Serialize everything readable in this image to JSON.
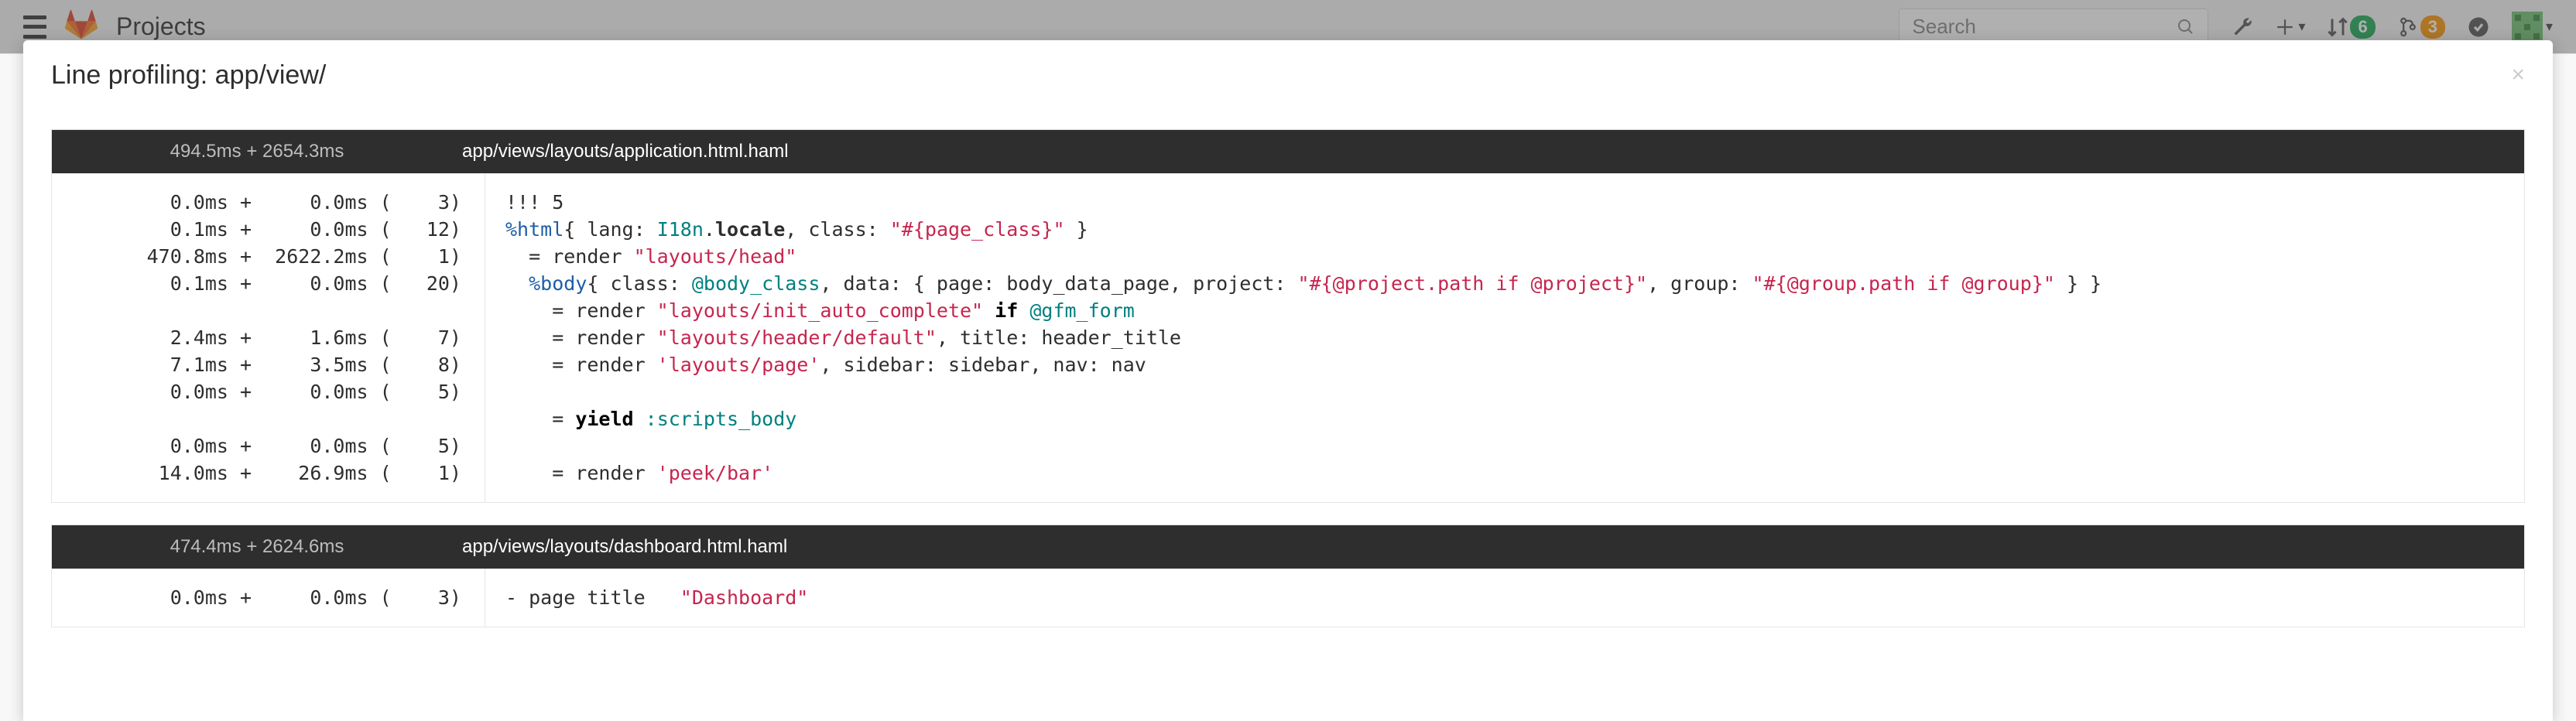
{
  "header": {
    "page_title": "Projects",
    "search_placeholder": "Search",
    "badge_mr": "6",
    "badge_issues": "3"
  },
  "modal": {
    "title": "Line profiling: app/view/",
    "close": "×"
  },
  "files": [
    {
      "timing_summary": "494.5ms + 2654.3ms",
      "path": "app/views/layouts/application.html.haml",
      "lines": [
        {
          "t": "0.0ms +     0.0ms (    3)",
          "code": [
            {
              "t": "!!! 5",
              "c": ""
            }
          ]
        },
        {
          "t": "0.1ms +     0.0ms (   12)",
          "code": [
            {
              "t": "%html",
              "c": "tok-tag"
            },
            {
              "t": "{ lang: ",
              "c": ""
            },
            {
              "t": "I18n",
              "c": "tok-key"
            },
            {
              "t": ".",
              "c": ""
            },
            {
              "t": "locale",
              "c": "tok-bold"
            },
            {
              "t": ", class: ",
              "c": ""
            },
            {
              "t": "\"#{page_class}\"",
              "c": "tok-str"
            },
            {
              "t": " }",
              "c": ""
            }
          ]
        },
        {
          "t": "470.8ms +  2622.2ms (    1)",
          "code": [
            {
              "t": "  = render ",
              "c": ""
            },
            {
              "t": "\"layouts/head\"",
              "c": "tok-str"
            }
          ]
        },
        {
          "t": "0.1ms +     0.0ms (   20)",
          "code": [
            {
              "t": "  ",
              "c": ""
            },
            {
              "t": "%body",
              "c": "tok-tag"
            },
            {
              "t": "{ class: ",
              "c": ""
            },
            {
              "t": "@body_class",
              "c": "tok-var"
            },
            {
              "t": ", data: { page: body_data_page, project: ",
              "c": ""
            },
            {
              "t": "\"#{@project.path if @project}\"",
              "c": "tok-str"
            },
            {
              "t": ", group: ",
              "c": ""
            },
            {
              "t": "\"#{@group.path if @group}\"",
              "c": "tok-str"
            },
            {
              "t": " } }",
              "c": ""
            }
          ]
        },
        {
          "t": "",
          "code": [
            {
              "t": "    = render ",
              "c": ""
            },
            {
              "t": "\"layouts/init_auto_complete\"",
              "c": "tok-str"
            },
            {
              "t": " ",
              "c": ""
            },
            {
              "t": "if",
              "c": "tok-kw"
            },
            {
              "t": " ",
              "c": ""
            },
            {
              "t": "@gfm_form",
              "c": "tok-var"
            }
          ]
        },
        {
          "t": "2.4ms +     1.6ms (    7)",
          "code": [
            {
              "t": "    = render ",
              "c": ""
            },
            {
              "t": "\"layouts/header/default\"",
              "c": "tok-str"
            },
            {
              "t": ", title: header_title",
              "c": ""
            }
          ]
        },
        {
          "t": "7.1ms +     3.5ms (    8)",
          "code": [
            {
              "t": "    = render ",
              "c": ""
            },
            {
              "t": "'layouts/page'",
              "c": "tok-str"
            },
            {
              "t": ", sidebar: sidebar, nav: nav",
              "c": ""
            }
          ]
        },
        {
          "t": "0.0ms +     0.0ms (    5)",
          "code": [
            {
              "t": "",
              "c": ""
            }
          ]
        },
        {
          "t": "",
          "code": [
            {
              "t": "    = ",
              "c": ""
            },
            {
              "t": "yield",
              "c": "tok-kw"
            },
            {
              "t": " ",
              "c": ""
            },
            {
              "t": ":scripts_body",
              "c": "tok-key"
            }
          ]
        },
        {
          "t": "0.0ms +     0.0ms (    5)",
          "code": [
            {
              "t": "",
              "c": ""
            }
          ]
        },
        {
          "t": "14.0ms +    26.9ms (    1)",
          "code": [
            {
              "t": "    = render ",
              "c": ""
            },
            {
              "t": "'peek/bar'",
              "c": "tok-str"
            }
          ]
        }
      ]
    },
    {
      "timing_summary": "474.4ms + 2624.6ms",
      "path": "app/views/layouts/dashboard.html.haml",
      "lines": [
        {
          "t": "0.0ms +     0.0ms (    3)",
          "code": [
            {
              "t": "- page title   ",
              "c": ""
            },
            {
              "t": "\"Dashboard\"",
              "c": "tok-str"
            }
          ]
        }
      ]
    }
  ]
}
